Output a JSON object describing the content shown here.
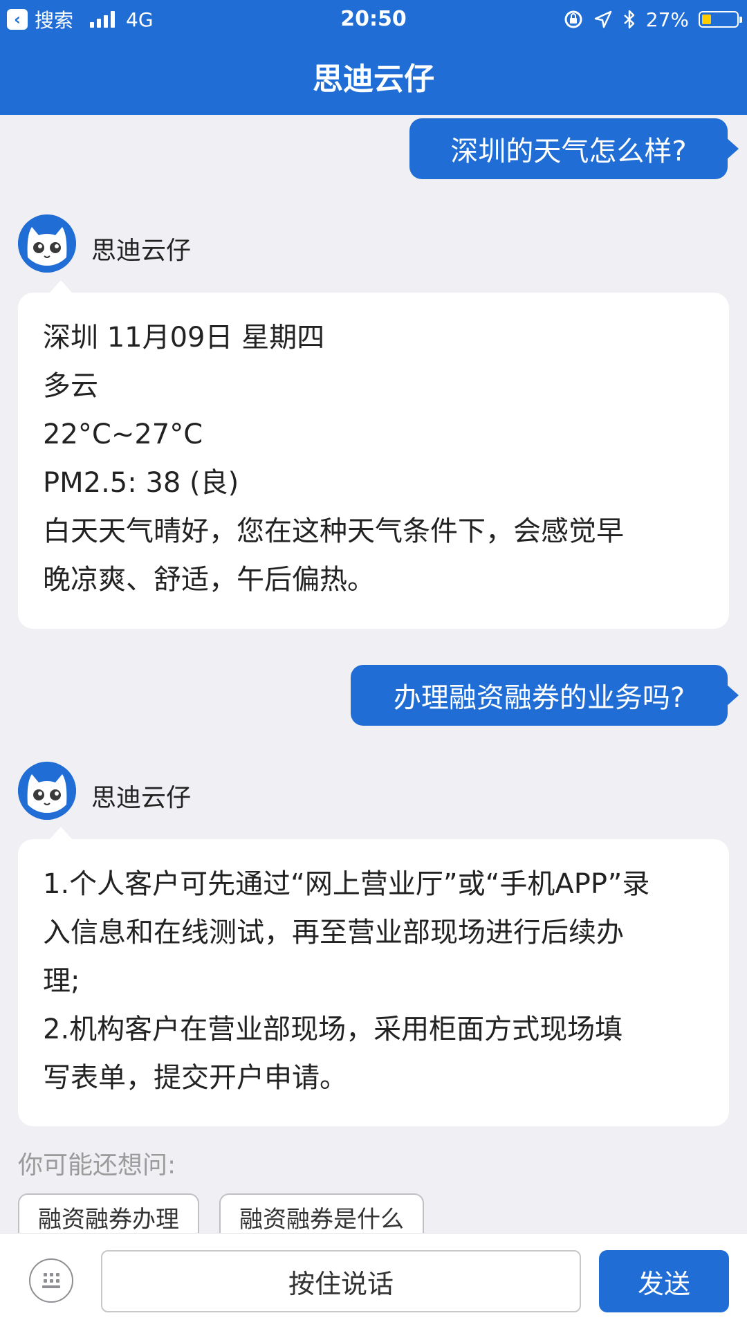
{
  "status_bar": {
    "back_label": "搜索",
    "network": "4G",
    "time": "20:50",
    "battery": "27%",
    "battery_level": 0.27,
    "icons": [
      "signal-icon",
      "orientation-lock-icon",
      "location-icon",
      "bluetooth-icon",
      "battery-icon"
    ]
  },
  "header": {
    "title": "思迪云仔"
  },
  "colors": {
    "primary": "#1f6dd5",
    "background": "#efeff4",
    "bubble_bot": "#ffffff",
    "battery_fill": "#ffcc00"
  },
  "messages": [
    {
      "from": "user",
      "text": "深圳的天气怎么样?"
    },
    {
      "from": "bot",
      "name": "思迪云仔",
      "lines": [
        "深圳 11月09日 星期四",
        "多云",
        "22°C~27°C",
        "PM2.5: 38 (良)",
        "白天天气晴好，您在这种天气条件下，会感觉早",
        "晚凉爽、舒适，午后偏热。"
      ]
    },
    {
      "from": "user",
      "text": "办理融资融券的业务吗?"
    },
    {
      "from": "bot",
      "name": "思迪云仔",
      "lines": [
        "1.个人客户可先通过“网上营业厅”或“手机APP”录",
        "入信息和在线测试，再至营业部现场进行后续办",
        "理;",
        "2.机构客户在营业部现场，采用柜面方式现场填",
        "写表单，提交开户申请。"
      ]
    }
  ],
  "suggestions": {
    "label": "你可能还想问:",
    "items": [
      "融资融券办理",
      "融资融券是什么"
    ]
  },
  "input_bar": {
    "voice_label": "按住说话",
    "send_label": "发送",
    "keyboard_icon": "keyboard-icon"
  }
}
